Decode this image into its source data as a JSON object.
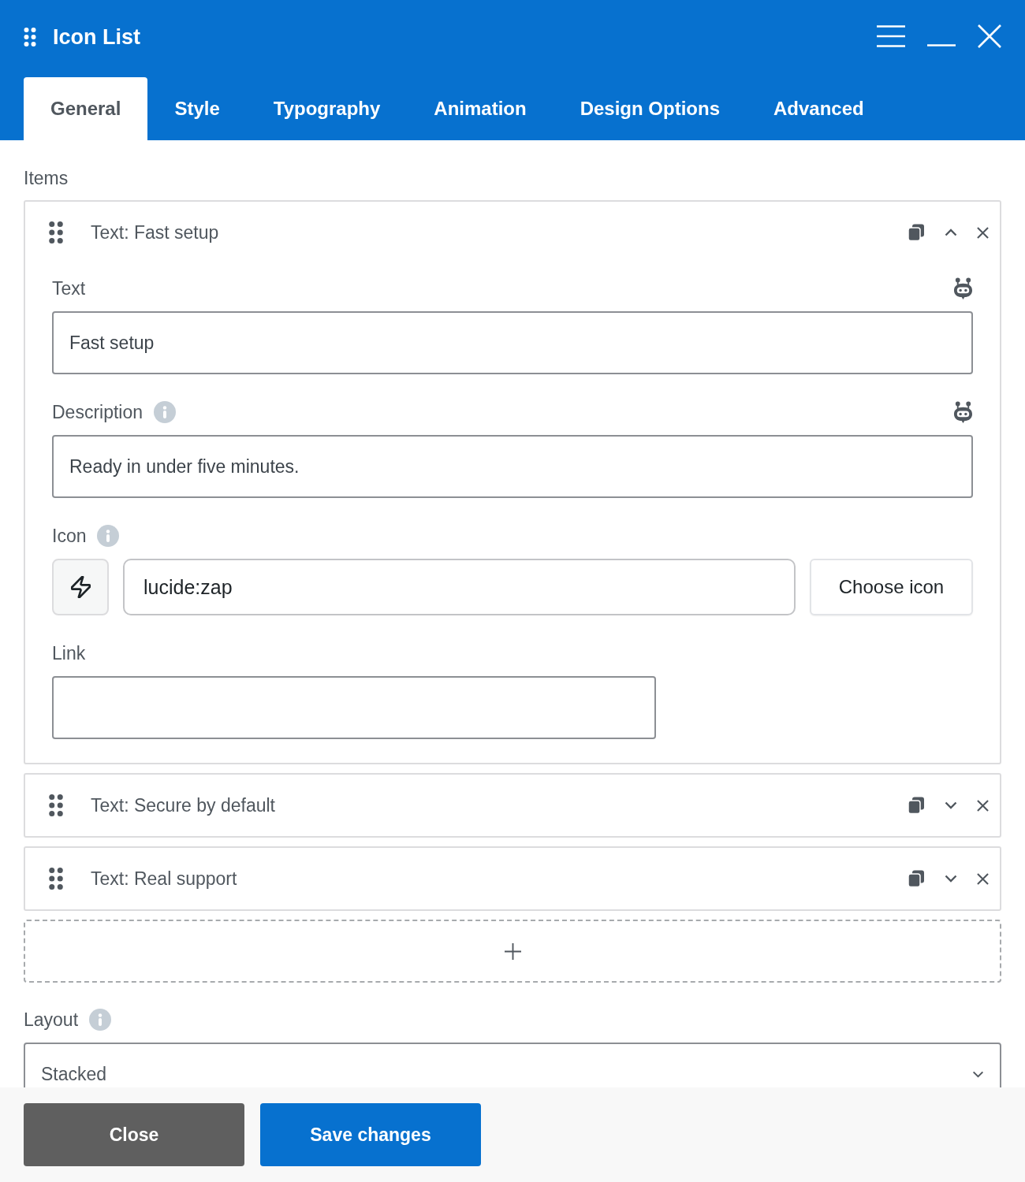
{
  "window": {
    "title": "Icon List"
  },
  "tabs": [
    {
      "label": "General",
      "selected": true
    },
    {
      "label": "Style",
      "selected": false
    },
    {
      "label": "Typography",
      "selected": false
    },
    {
      "label": "Animation",
      "selected": false
    },
    {
      "label": "Design Options",
      "selected": false
    },
    {
      "label": "Advanced",
      "selected": false
    }
  ],
  "items_section": {
    "label": "Items"
  },
  "items": [
    {
      "title": "Text: Fast setup",
      "expanded": true,
      "fields": [
        {
          "kind": "text",
          "label": "Text",
          "value": "Fast setup",
          "info": false,
          "ai": true
        },
        {
          "kind": "text",
          "label": "Description",
          "value": "Ready in under five minutes.",
          "info": true,
          "ai": true
        },
        {
          "kind": "icon",
          "label": "Icon",
          "value": "lucide:zap",
          "info": true,
          "ai": false,
          "button": "Choose icon"
        },
        {
          "kind": "link",
          "label": "Link",
          "info": false,
          "ai": false
        }
      ]
    },
    {
      "title": "Text: Secure by default",
      "expanded": false
    },
    {
      "title": "Text: Real support",
      "expanded": false
    }
  ],
  "layout": {
    "label": "Layout",
    "info": true,
    "value": "Stacked"
  },
  "footer": {
    "buttons": [
      {
        "label": "Close",
        "kind": "secondary"
      },
      {
        "label": "Save changes",
        "kind": "primary"
      }
    ]
  }
}
